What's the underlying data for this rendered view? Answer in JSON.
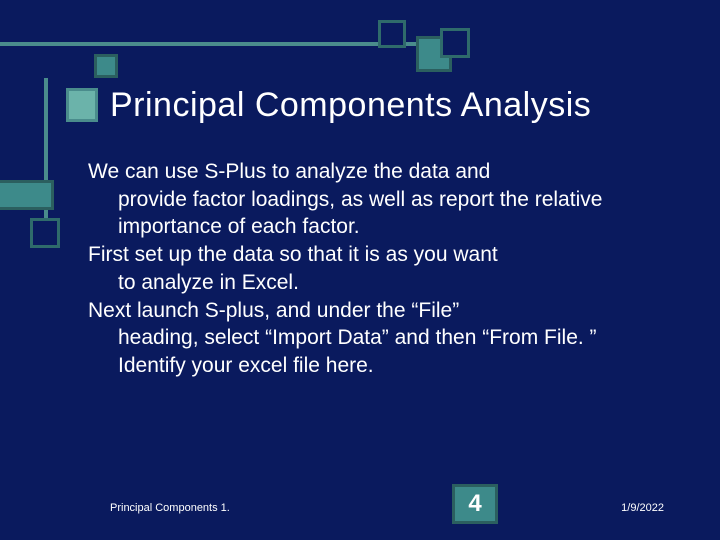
{
  "title": "Principal Components Analysis",
  "body": {
    "p1a": "We can use S-Plus to analyze the data and",
    "p1b": "provide factor loadings, as well as report the relative importance of each factor.",
    "p2a": "First set up the data so that it is as you want",
    "p2b": "to analyze in Excel.",
    "p3a": "Next launch S-plus, and under the “File”",
    "p3b": "heading, select “Import Data” and then “From File. ”  Identify your excel file here."
  },
  "footer": {
    "left": "Principal Components 1.",
    "slide_number": "4",
    "date": "1/9/2022"
  }
}
